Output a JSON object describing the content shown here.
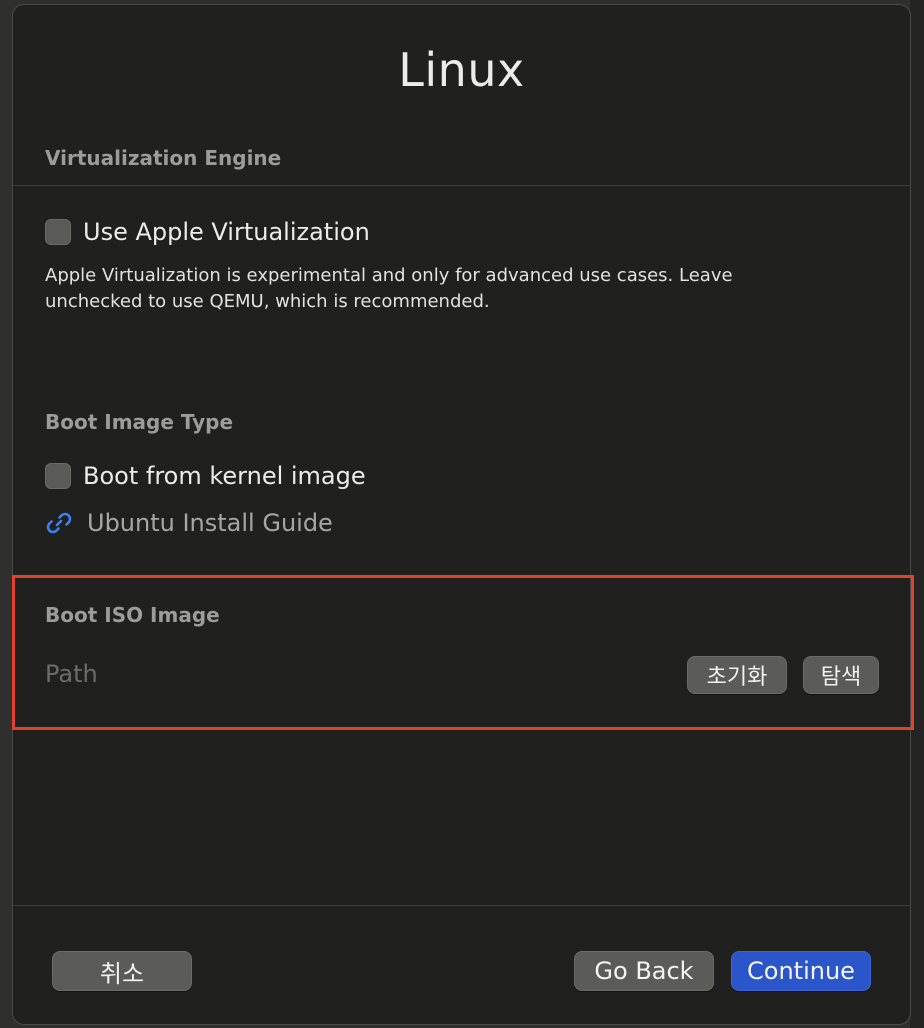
{
  "dialog": {
    "title": "Linux"
  },
  "virtualization": {
    "section_label": "Virtualization Engine",
    "checkbox_label": "Use Apple Virtualization",
    "checked": false,
    "description": "Apple Virtualization is experimental and only for advanced use cases. Leave unchecked to use QEMU, which is recommended."
  },
  "boot_image_type": {
    "section_label": "Boot Image Type",
    "checkbox_label": "Boot from kernel image",
    "checked": false,
    "guide_link": "Ubuntu Install Guide"
  },
  "boot_iso": {
    "section_label": "Boot ISO Image",
    "path_placeholder": "Path",
    "reset_label": "초기화",
    "browse_label": "탐색"
  },
  "footer": {
    "cancel_label": "취소",
    "back_label": "Go Back",
    "continue_label": "Continue"
  },
  "colors": {
    "accent": "#2b56c9",
    "highlight": "#e0422b",
    "link_icon": "#3b82f6"
  },
  "icons": {
    "guide_link_icon": "link-icon"
  }
}
